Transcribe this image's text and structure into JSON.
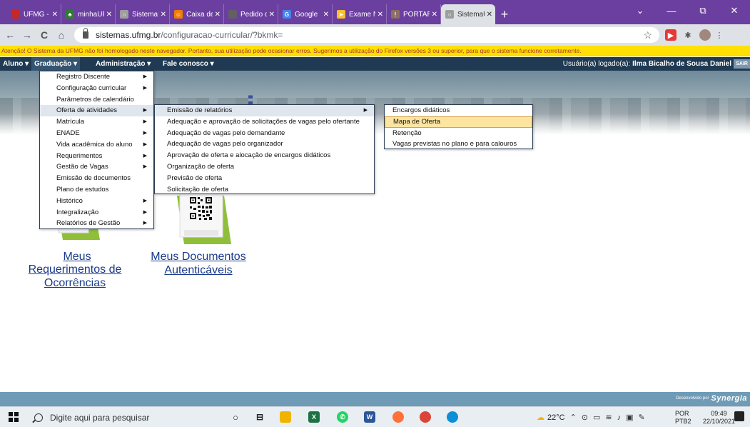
{
  "browser": {
    "tabs": [
      {
        "title": "UFMG - Un",
        "favicon_color": "#c62828",
        "favicon_glyph": ""
      },
      {
        "title": "minhaUFMG",
        "favicon_color": "#2e7d32",
        "favicon_glyph": "♣"
      },
      {
        "title": "SistemaUF",
        "favicon_color": "#9e9e9e",
        "favicon_glyph": "○"
      },
      {
        "title": "Caixa de e",
        "favicon_color": "#f57c00",
        "favicon_glyph": "☺"
      },
      {
        "title": "Pedido de",
        "favicon_color": "#616161",
        "favicon_glyph": ""
      },
      {
        "title": "Google",
        "favicon_color": "#4285f4",
        "favicon_glyph": "G"
      },
      {
        "title": "Exame Na",
        "favicon_color": "#fbc02d",
        "favicon_glyph": "➤"
      },
      {
        "title": "PORTARIA",
        "favicon_color": "#8d6e63",
        "favicon_glyph": "!"
      },
      {
        "title": "SistemaUF",
        "favicon_color": "#9e9e9e",
        "favicon_glyph": "○"
      }
    ],
    "active_tab_index": 8,
    "new_tab_glyph": "+",
    "window_controls": {
      "minimize": "—",
      "maximize": "⧉",
      "close": "✕",
      "chevron": "⌄"
    },
    "nav": {
      "back": "←",
      "forward": "→",
      "reload": "C",
      "home": "⌂"
    },
    "url_host": "sistemas.ufmg.br",
    "url_path": "/configuracao-curricular/?bkmk=",
    "star": "☆"
  },
  "warning_text": "Atenção! O Sistema da UFMG não foi homologado neste navegador. Portanto, sua utilização pode ocasionar erros. Sugerimos a utilização do Firefox versões 3 ou superior, para que o sistema funcione corretamente.",
  "menubar": {
    "items": [
      "Aluno ▾",
      "Graduação ▾",
      "Administração ▾",
      "Fale conosco ▾"
    ],
    "user_label": "Usuário(a) logado(a):",
    "user_name": "Ilma Bicalho de Sousa Daniel",
    "exit": "SAIR"
  },
  "menu_graduacao": [
    {
      "label": "Registro Discente",
      "submenu": true
    },
    {
      "label": "Configuração curricular",
      "submenu": true
    },
    {
      "label": "Parâmetros de calendário",
      "submenu": false
    },
    {
      "label": "Oferta de atividades",
      "submenu": true
    },
    {
      "label": "Matrícula",
      "submenu": true
    },
    {
      "label": "ENADE",
      "submenu": true
    },
    {
      "label": "Vida acadêmica do aluno",
      "submenu": true
    },
    {
      "label": "Requerimentos",
      "submenu": true
    },
    {
      "label": "Gestão de Vagas",
      "submenu": true
    },
    {
      "label": "Emissão de documentos",
      "submenu": false
    },
    {
      "label": "Plano de estudos",
      "submenu": false
    },
    {
      "label": "Histórico",
      "submenu": true
    },
    {
      "label": "Integralização",
      "submenu": true
    },
    {
      "label": "Relatórios de Gestão",
      "submenu": true
    }
  ],
  "menu_oferta": [
    {
      "label": "Emissão de relatórios",
      "submenu": true
    },
    {
      "label": "Adequação e aprovação de solicitações de vagas pelo ofertante",
      "submenu": false
    },
    {
      "label": "Adequação de vagas pelo demandante",
      "submenu": false
    },
    {
      "label": "Adequação de vagas pelo organizador",
      "submenu": false
    },
    {
      "label": "Aprovação de oferta e alocação de encargos didáticos",
      "submenu": false
    },
    {
      "label": "Organização de oferta",
      "submenu": false
    },
    {
      "label": "Previsão de oferta",
      "submenu": false
    },
    {
      "label": "Solicitação de oferta",
      "submenu": false
    }
  ],
  "menu_relatorios": [
    {
      "label": "Encargos didáticos"
    },
    {
      "label": "Mapa de Oferta"
    },
    {
      "label": "Retenção"
    },
    {
      "label": "Vagas previstas no plano e para calouros"
    }
  ],
  "cards": {
    "card1_line1": "Meus",
    "card1_line2": "Requerimentos de",
    "card1_line3": "Ocorrências",
    "card2_line1": "Meus Documentos",
    "card2_line2": "Autenticáveis"
  },
  "footer": {
    "dev_label": "Desenvolvido por",
    "dev_brand": "Synergia"
  },
  "taskbar": {
    "search_placeholder": "Digite aqui para pesquisar",
    "weather": "22°C",
    "lang_line1": "POR",
    "lang_line2": "PTB2",
    "time": "09:49",
    "date": "22/10/2021"
  }
}
